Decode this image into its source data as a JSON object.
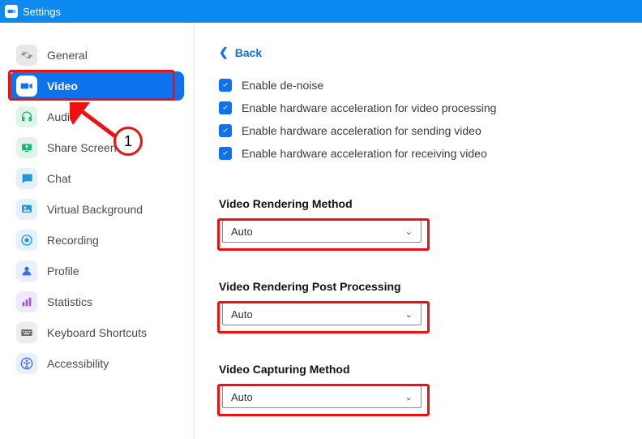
{
  "titlebar": {
    "title": "Settings"
  },
  "sidebar": {
    "items": [
      {
        "id": "general",
        "label": "General",
        "icon": "gear",
        "iconBg": "#e8e8e8",
        "iconFg": "#8a8a8a"
      },
      {
        "id": "video",
        "label": "Video",
        "icon": "video",
        "iconBg": "#ffffff",
        "iconFg": "#0e72ec",
        "active": true
      },
      {
        "id": "audio",
        "label": "Audio",
        "icon": "headphones",
        "iconBg": "#e0f4ea",
        "iconFg": "#22b573"
      },
      {
        "id": "share-screen",
        "label": "Share Screen",
        "icon": "share",
        "iconBg": "#e0f4ea",
        "iconFg": "#22b573"
      },
      {
        "id": "chat",
        "label": "Chat",
        "icon": "chat",
        "iconBg": "#e4f0fb",
        "iconFg": "#1f99d6"
      },
      {
        "id": "virtual-background",
        "label": "Virtual Background",
        "icon": "background",
        "iconBg": "#e4f0fb",
        "iconFg": "#1f99d6"
      },
      {
        "id": "recording",
        "label": "Recording",
        "icon": "record",
        "iconBg": "#e4f0fb",
        "iconFg": "#1f99d6"
      },
      {
        "id": "profile",
        "label": "Profile",
        "icon": "profile",
        "iconBg": "#e8effd",
        "iconFg": "#3b6fe0"
      },
      {
        "id": "statistics",
        "label": "Statistics",
        "icon": "stats",
        "iconBg": "#f0e8fb",
        "iconFg": "#9b59d0"
      },
      {
        "id": "keyboard-shortcuts",
        "label": "Keyboard Shortcuts",
        "icon": "keyboard",
        "iconBg": "#ededed",
        "iconFg": "#6b6b6b"
      },
      {
        "id": "accessibility",
        "label": "Accessibility",
        "icon": "accessibility",
        "iconBg": "#e8effd",
        "iconFg": "#3b6fe0"
      }
    ]
  },
  "annotation": {
    "badge": "1"
  },
  "main": {
    "back": "Back",
    "checks": [
      {
        "label": "Enable de-noise"
      },
      {
        "label": "Enable hardware acceleration for video processing"
      },
      {
        "label": "Enable hardware acceleration for sending video"
      },
      {
        "label": "Enable hardware acceleration for receiving video"
      }
    ],
    "sections": [
      {
        "label": "Video Rendering Method",
        "value": "Auto"
      },
      {
        "label": "Video Rendering Post Processing",
        "value": "Auto"
      },
      {
        "label": "Video Capturing Method",
        "value": "Auto"
      }
    ]
  }
}
